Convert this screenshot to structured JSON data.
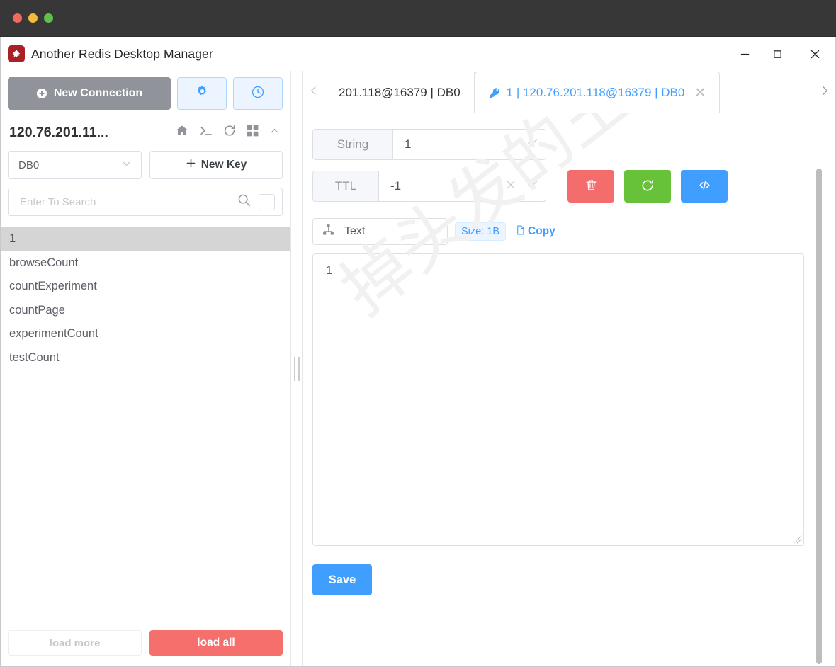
{
  "window": {
    "app_title": "Another Redis Desktop Manager",
    "logo_icon": "redis-logo-icon",
    "controls": {
      "minimize": "minimize-icon",
      "maximize": "maximize-icon",
      "close": "close-icon"
    },
    "traffic_lights": [
      "close-dot",
      "minimize-dot",
      "zoom-dot"
    ]
  },
  "sidebar": {
    "new_connection_label": "New Connection",
    "settings_icon": "gear-icon",
    "history_icon": "clock-icon",
    "connection_name": "120.76.201.11...",
    "connection_icons": [
      "home-icon",
      "terminal-icon",
      "refresh-icon",
      "grid-icon",
      "chevron-up-icon"
    ],
    "db_selected": "DB0",
    "new_key_label": "New Key",
    "search_placeholder": "Enter To Search",
    "search_value": "",
    "search_icon": "search-icon",
    "search_checkbox": "exact-match-checkbox",
    "keys": [
      {
        "label": "1",
        "selected": true
      },
      {
        "label": "browseCount",
        "selected": false
      },
      {
        "label": "countExperiment",
        "selected": false
      },
      {
        "label": "countPage",
        "selected": false
      },
      {
        "label": "experimentCount",
        "selected": false
      },
      {
        "label": "testCount",
        "selected": false
      }
    ],
    "load_more_label": "load more",
    "load_all_label": "load all"
  },
  "tabs": {
    "prev_arrow": "chevron-left-icon",
    "next_arrow": "chevron-right-icon",
    "items": [
      {
        "label": "201.118@16379 | DB0",
        "active": false,
        "closable": false
      },
      {
        "label": "1 | 120.76.201.118@16379 | DB0",
        "active": true,
        "closable": true,
        "key_icon": "key-icon",
        "close_icon": "close-icon"
      }
    ]
  },
  "editor": {
    "type_label": "String",
    "key_name": "1",
    "key_confirm_icon": "check-icon",
    "ttl_label": "TTL",
    "ttl_value": "-1",
    "ttl_clear_icon": "close-icon",
    "ttl_confirm_icon": "check-icon",
    "actions": {
      "delete_icon": "trash-icon",
      "reload_icon": "refresh-icon",
      "code_icon": "code-icon"
    },
    "format_icon": "sitemap-icon",
    "format_selected": "Text",
    "size_badge": "Size: 1B",
    "copy_label": "Copy",
    "copy_icon": "document-icon",
    "value_text": "1",
    "save_label": "Save",
    "watermark_text": "掉头发的王富贵"
  },
  "colors": {
    "accent_blue": "#409eff",
    "danger_red": "#f56c6c",
    "success_green": "#67c23a",
    "load_all_red": "#f5706c",
    "new_connection_gray": "#909399",
    "selected_key_bg": "#d5d5d5",
    "titlebar_dark": "#373737"
  }
}
